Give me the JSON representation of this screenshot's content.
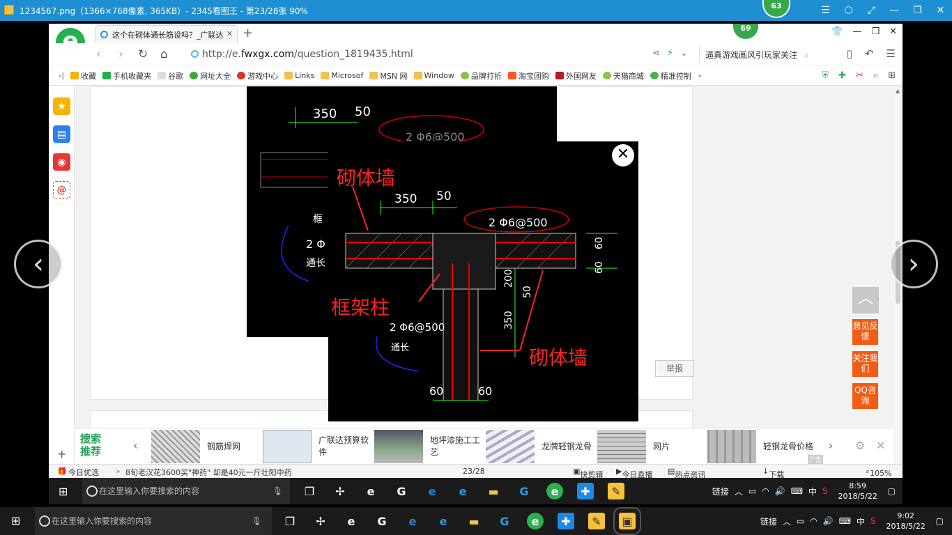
{
  "viewer": {
    "title": "1234567.png（1366×768像素, 365KB）- 2345看图王 - 第23/28张 90%",
    "badge_top": "63",
    "badge_browser": "69"
  },
  "browser": {
    "tab_title": "这个在砌体通长筋设吗？_广联达",
    "url_prefix": "http://e.",
    "url_domain": "fwxgx.com",
    "url_path": "/question_1819435.html",
    "search_hint": "逼真游戏画风引玩家关注"
  },
  "bookmarks": [
    {
      "label": "收藏",
      "color": "#f5b400"
    },
    {
      "label": "手机收藏夹",
      "color": "#22b14c"
    },
    {
      "label": "谷歌",
      "color": "#cccccc"
    },
    {
      "label": "网址大全",
      "color": "#3aa83a"
    },
    {
      "label": "游戏中心",
      "color": "#e0302a"
    },
    {
      "label": "Links",
      "color": "#f2c14e"
    },
    {
      "label": "Microsof",
      "color": "#f2c14e"
    },
    {
      "label": "MSN 网",
      "color": "#f2c14e"
    },
    {
      "label": "Window",
      "color": "#f2c14e"
    },
    {
      "label": "品牌打折",
      "color": "#8bc34a"
    },
    {
      "label": "淘宝团购",
      "color": "#ff5722"
    },
    {
      "label": "外国网友",
      "color": "#b71c1c"
    },
    {
      "label": "天猫商城",
      "color": "#8bc34a"
    },
    {
      "label": "精准控制",
      "color": "#4caf50"
    }
  ],
  "drawing": {
    "label_wall_top": "砌体墙",
    "label_column": "框架柱",
    "label_wall_bottom": "砌体墙",
    "dim_350": "350",
    "dim_50": "50",
    "rebar_top": "2 Φ6@500",
    "rebar_bottom": "2 Φ6@500",
    "dim_60_right_a": "60",
    "dim_60_right_b": "60",
    "dim_200": "200",
    "dim_50_v": "50",
    "dim_350_v": "350",
    "dim_60_bottom_a": "60",
    "dim_60_bottom_b": "60",
    "tongchang": "通长",
    "back_350": "350",
    "back_50": "50",
    "back_rebar": "2 Φ6@500",
    "back_frame": "框",
    "back_2phi": "2 Φ",
    "back_tongchang": "通长"
  },
  "page": {
    "report": "举报"
  },
  "float_buttons": {
    "top_icon": "top-arrow",
    "feedback": "意见反馈",
    "follow": "关注我们",
    "qq": "QQ咨询"
  },
  "adbar": {
    "label": "搜索推荐",
    "items": [
      {
        "text": "钢筋焊网"
      },
      {
        "text": "广联达预算软件"
      },
      {
        "text": "地坪漆施工工艺"
      },
      {
        "text": "龙牌轻钢龙骨"
      },
      {
        "text": "网片"
      },
      {
        "text": "轻钢龙骨价格"
      }
    ],
    "ad_tag": "广告"
  },
  "statusbar": {
    "today": "今日优选",
    "news": "8旬老汉花3600买\"神药\" 却是40元一斤壮阳中药",
    "page_count": "23/28",
    "quick_cut": "快剪辑",
    "live": "今日直播",
    "hot": "热点资讯",
    "download": "下载",
    "zoom": "105%"
  },
  "taskbar_inner": {
    "search_placeholder": "在这里输入你要搜索的内容",
    "tray_link": "链接",
    "ime": "中",
    "time": "8:59",
    "date": "2018/5/22"
  },
  "taskbar_outer": {
    "search_placeholder": "在这里输入你要搜索的内容",
    "tray_link": "链接",
    "ime": "中",
    "time": "9:02",
    "date": "2018/5/22"
  }
}
